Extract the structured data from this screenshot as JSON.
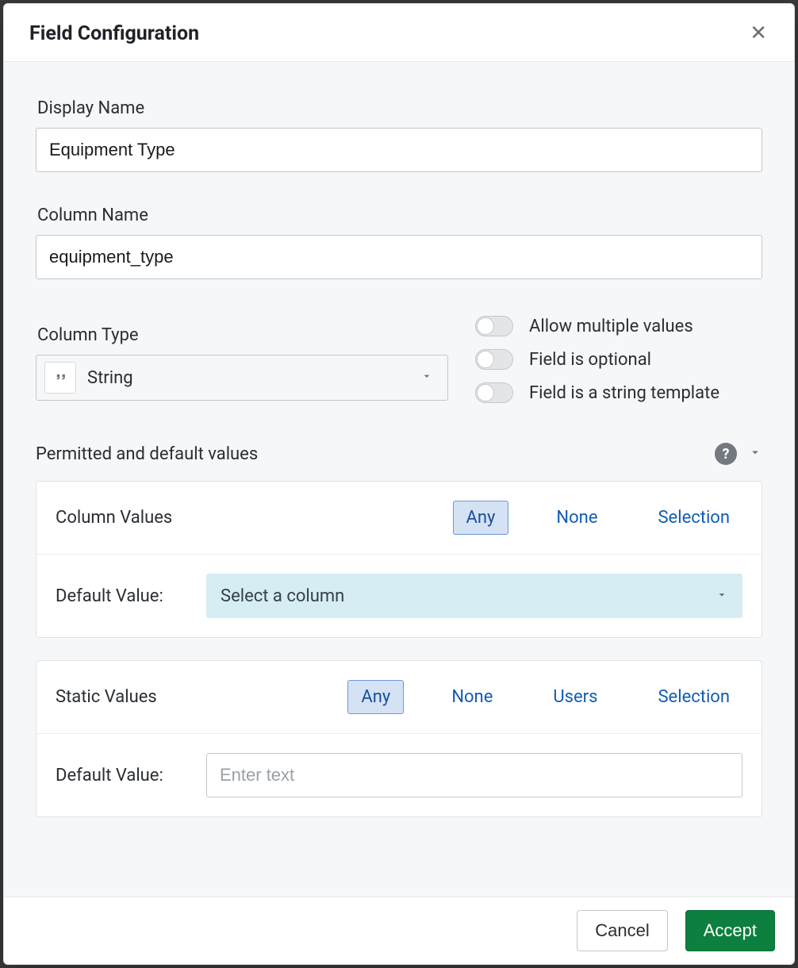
{
  "dialog": {
    "title": "Field Configuration",
    "close_symbol": "✕"
  },
  "display_name": {
    "label": "Display Name",
    "value": "Equipment Type"
  },
  "column_name": {
    "label": "Column Name",
    "value": "equipment_type"
  },
  "column_type": {
    "label": "Column Type",
    "selected": "String"
  },
  "toggles": {
    "allow_multiple": "Allow multiple values",
    "optional": "Field is optional",
    "string_template": "Field is a string template"
  },
  "permitted": {
    "section_title": "Permitted and default values",
    "column_values": {
      "label": "Column Values",
      "options": {
        "any": "Any",
        "none": "None",
        "selection": "Selection"
      }
    },
    "column_default": {
      "label": "Default Value:",
      "placeholder": "Select a column"
    },
    "static_values": {
      "label": "Static Values",
      "options": {
        "any": "Any",
        "none": "None",
        "users": "Users",
        "selection": "Selection"
      }
    },
    "static_default": {
      "label": "Default Value:",
      "placeholder": "Enter text"
    }
  },
  "footer": {
    "cancel": "Cancel",
    "accept": "Accept"
  }
}
